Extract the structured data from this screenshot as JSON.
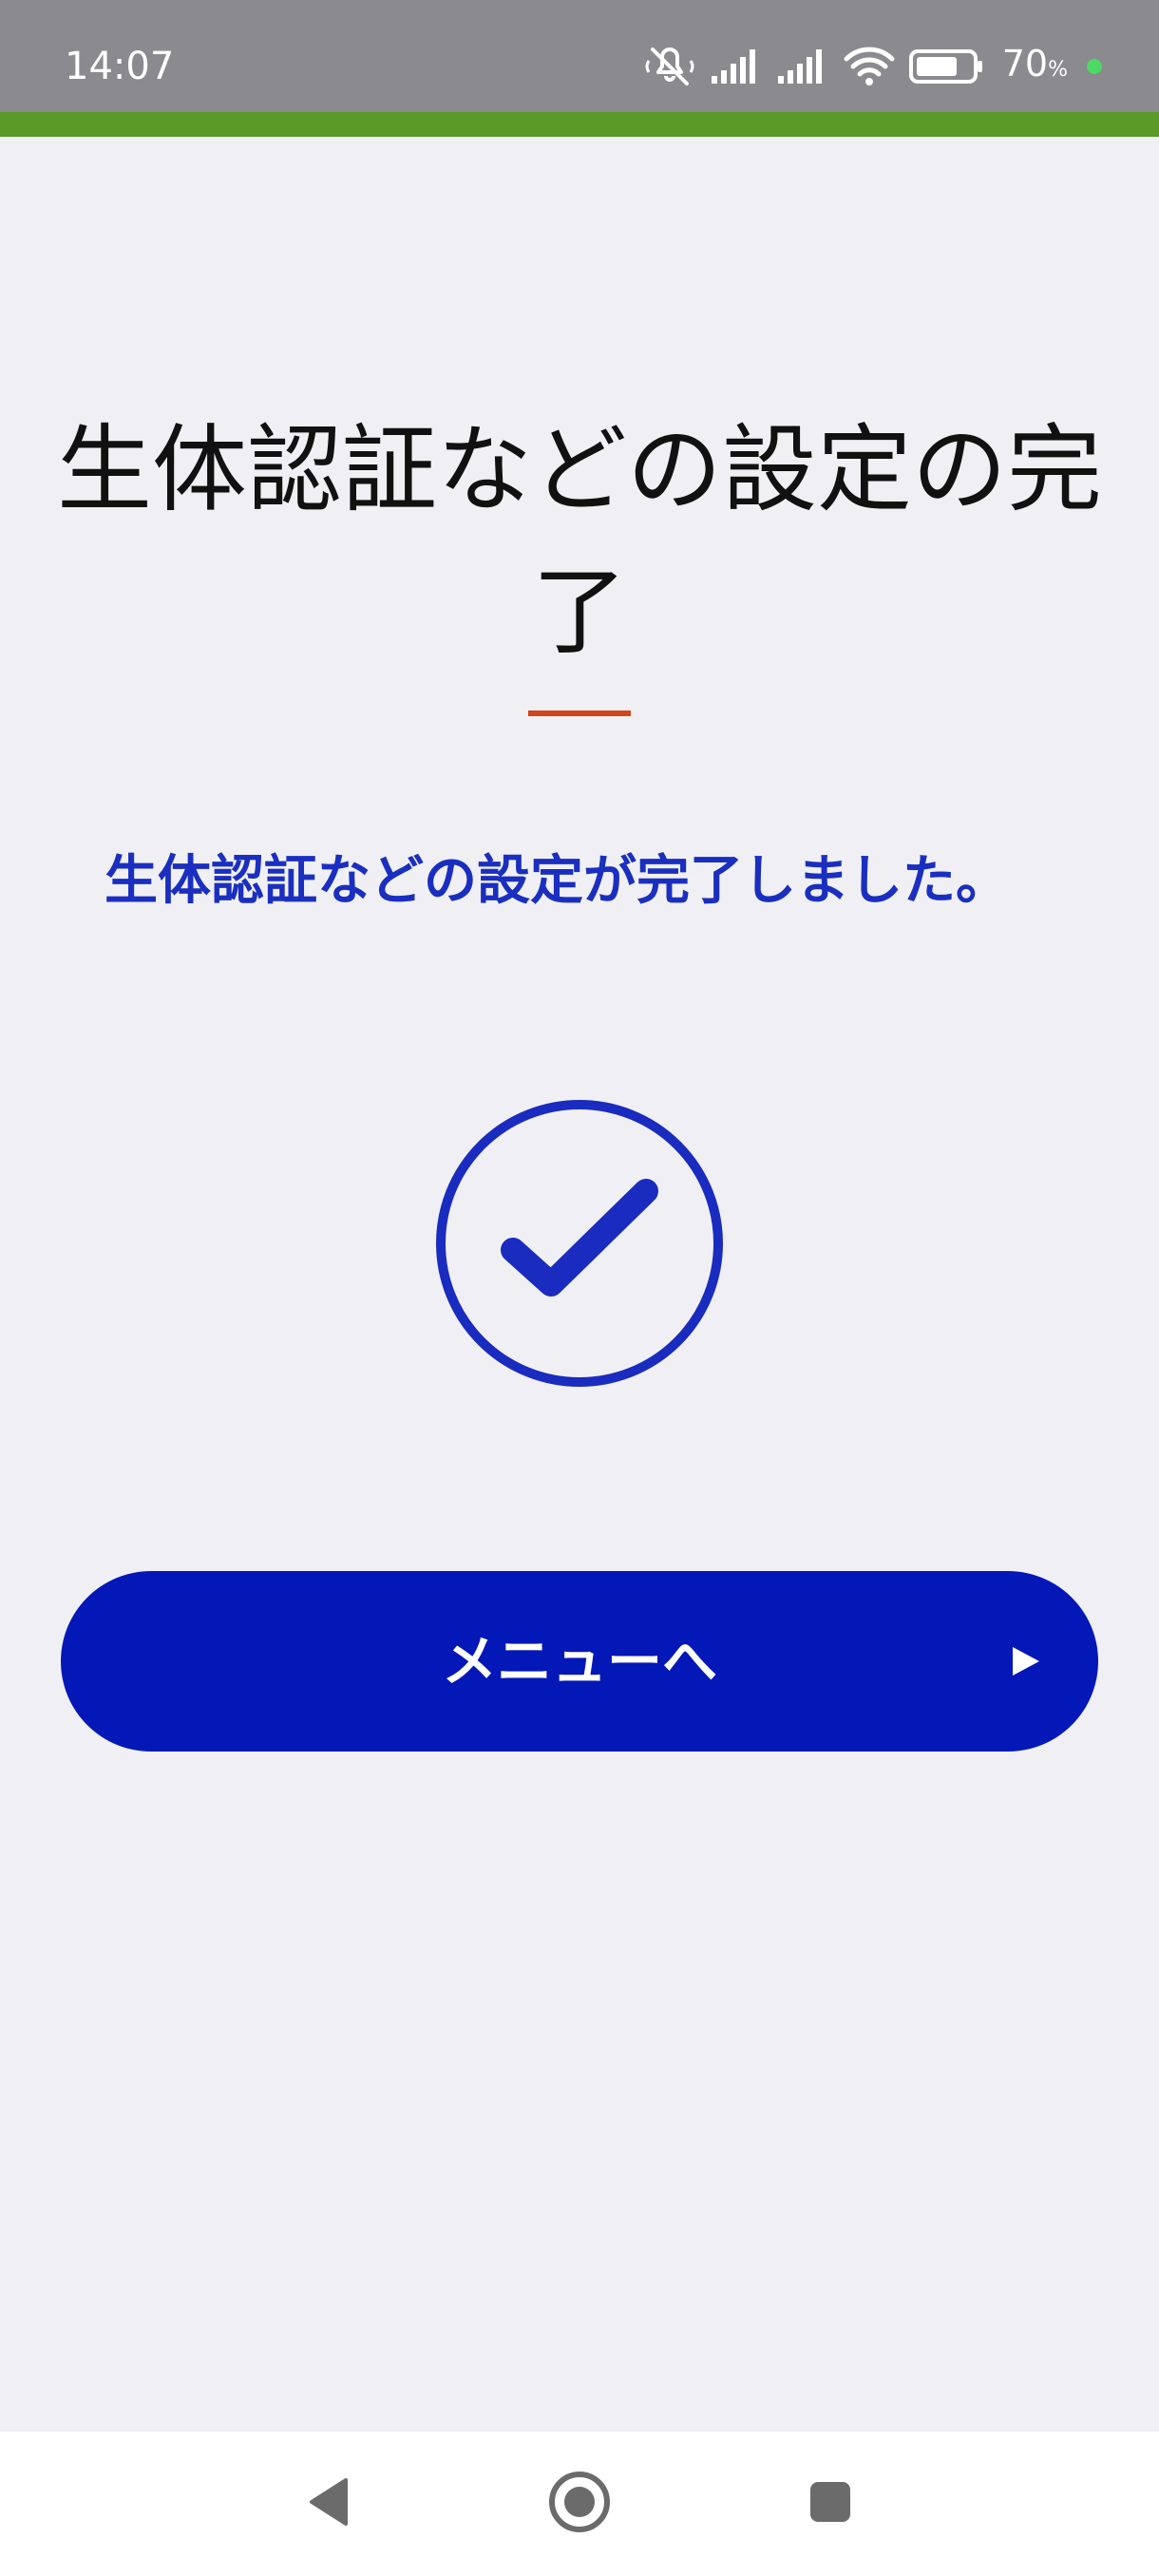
{
  "status_bar": {
    "time": "14:07",
    "battery_percent": "70",
    "battery_unit": "%",
    "icons": [
      "silent-vibrate-icon",
      "signal-icon",
      "signal-icon",
      "wifi-icon",
      "battery-icon",
      "privacy-dot-icon"
    ]
  },
  "colors": {
    "status_bar": "#8a8a8f",
    "accent_bar": "#5a9a26",
    "title_underline": "#d0451b",
    "message": "#1a2fbf",
    "button": "#0418b8",
    "background": "#f0f0f4"
  },
  "page": {
    "title_line1": "生体認証などの設定の完",
    "title_line2": "了",
    "message": "生体認証などの設定が完了しました。",
    "status_icon": "check-circle-icon"
  },
  "button": {
    "label": "メニューへ",
    "icon": "play-arrow-icon"
  },
  "nav": {
    "icons": [
      "back-icon",
      "home-icon",
      "recents-icon"
    ]
  }
}
